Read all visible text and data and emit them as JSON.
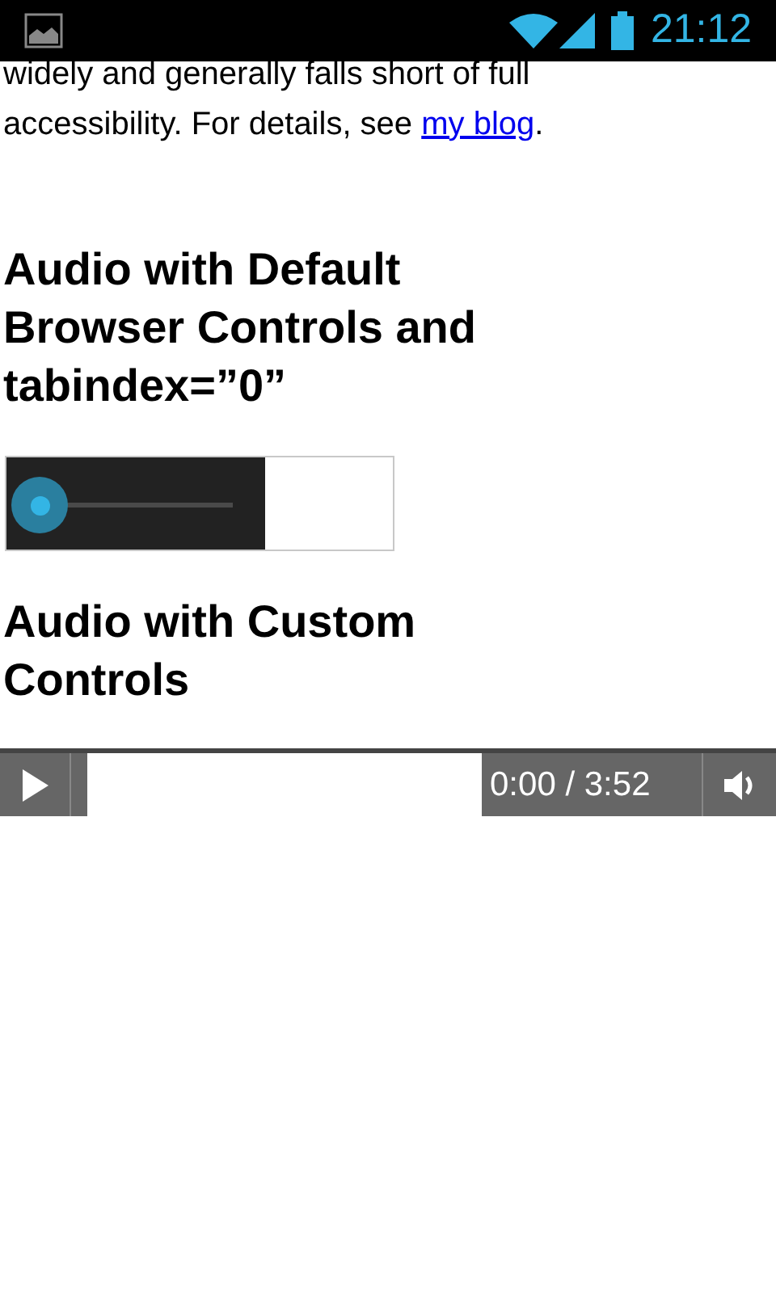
{
  "status_bar": {
    "time": "21:12"
  },
  "paragraph": {
    "text": "widely and generally falls short of full accessibility. For details, see ",
    "link": "my blog",
    "tail": "."
  },
  "sections": [
    {
      "heading": "Audio with Default Browser Controls and tabindex=”0”",
      "player": {
        "kind": "default"
      }
    },
    {
      "heading": "Audio with Custom Controls",
      "player": {
        "kind": "custom",
        "time": "0:00 / 3:52"
      }
    }
  ]
}
